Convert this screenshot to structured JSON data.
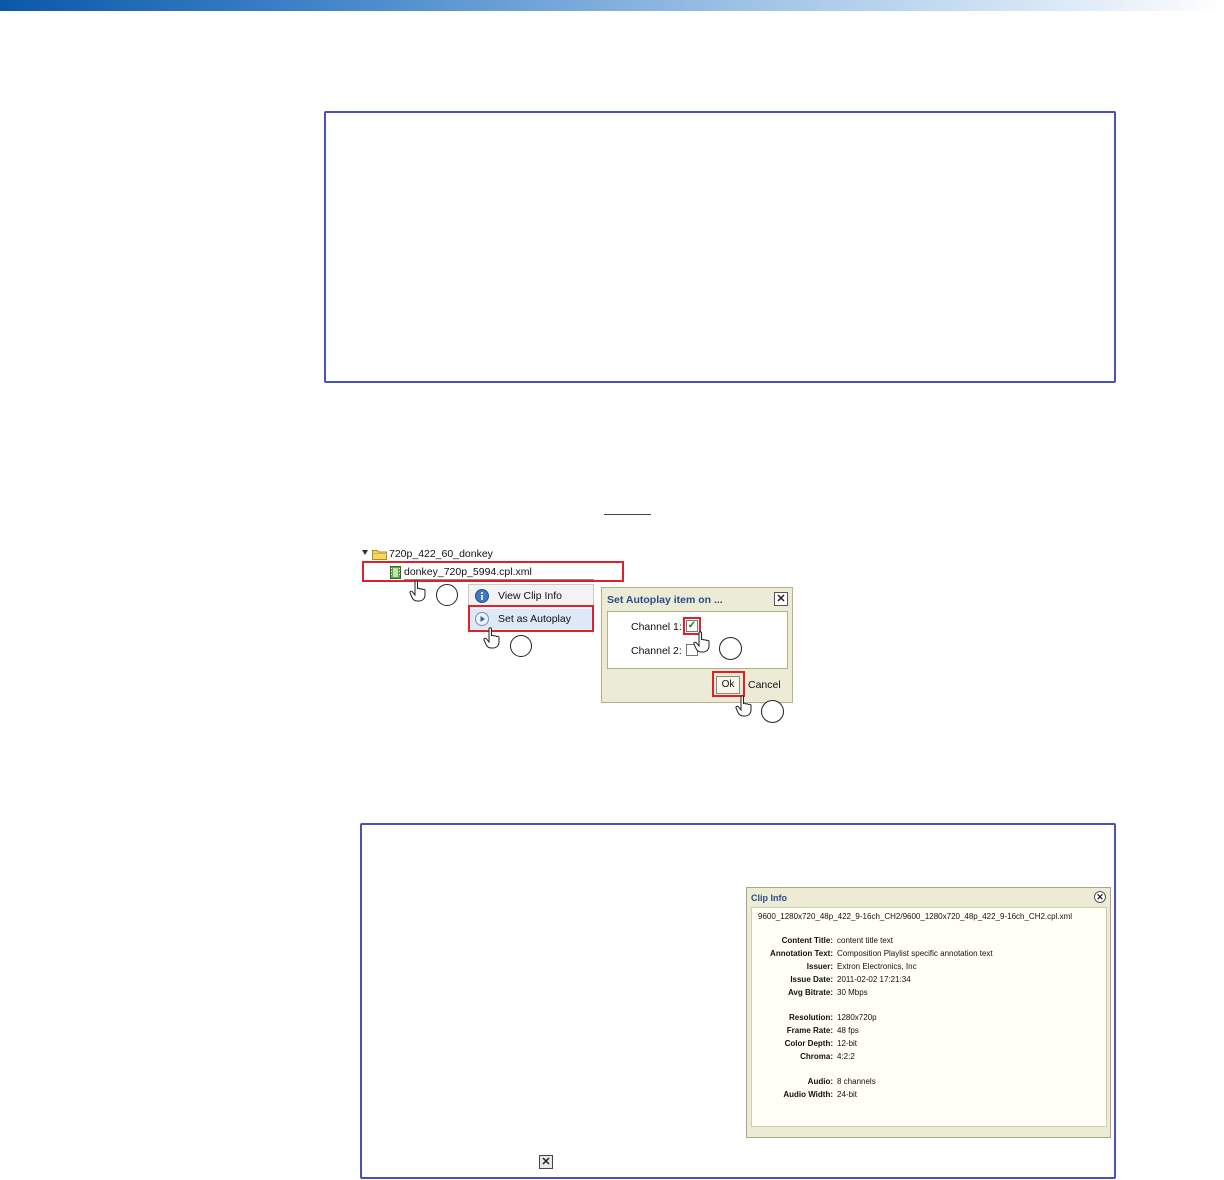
{
  "tree": {
    "folder_label": "720p_422_60_donkey",
    "file_label": "donkey_720p_5994.cpl.xml"
  },
  "context_menu": {
    "items": [
      {
        "label": "View Clip Info",
        "icon": "info-icon"
      },
      {
        "label": "Set as Autoplay",
        "icon": "play-icon"
      }
    ]
  },
  "autoplay_dialog": {
    "title": "Set Autoplay item on ...",
    "channel1_label": "Channel 1:",
    "channel1_checked": true,
    "channel2_label": "Channel 2:",
    "channel2_checked": false,
    "ok_label": "Ok",
    "cancel_label": "Cancel",
    "close_glyph": "✕"
  },
  "clip_info": {
    "title": "Clip Info",
    "path": "9600_1280x720_48p_422_9-16ch_CH2/9600_1280x720_48p_422_9-16ch_CH2.cpl.xml",
    "close_glyph": "✕",
    "fields": [
      {
        "label": "Content Title:",
        "value": "content title text"
      },
      {
        "label": "Annotation Text:",
        "value": "Composition Playlist specific annotation text"
      },
      {
        "label": "Issuer:",
        "value": "Extron Electronics, Inc"
      },
      {
        "label": "Issue Date:",
        "value": "2011-02-02  17:21:34"
      },
      {
        "label": "Avg Bitrate:",
        "value": "30 Mbps"
      },
      {
        "label": "Resolution:",
        "value": "1280x720p"
      },
      {
        "label": "Frame Rate:",
        "value": "48 fps"
      },
      {
        "label": "Color Depth:",
        "value": "12-bit"
      },
      {
        "label": "Chroma:",
        "value": "4:2:2"
      },
      {
        "label": "Audio:",
        "value": "8 channels"
      },
      {
        "label": "Audio Width:",
        "value": "24-bit"
      }
    ]
  },
  "standalone_close_glyph": "✕",
  "colors": {
    "highlight_red": "#e0202a",
    "note_border": "#4a52b4",
    "dialog_bg": "#ecebd6",
    "title_blue": "#2d4a8a"
  }
}
